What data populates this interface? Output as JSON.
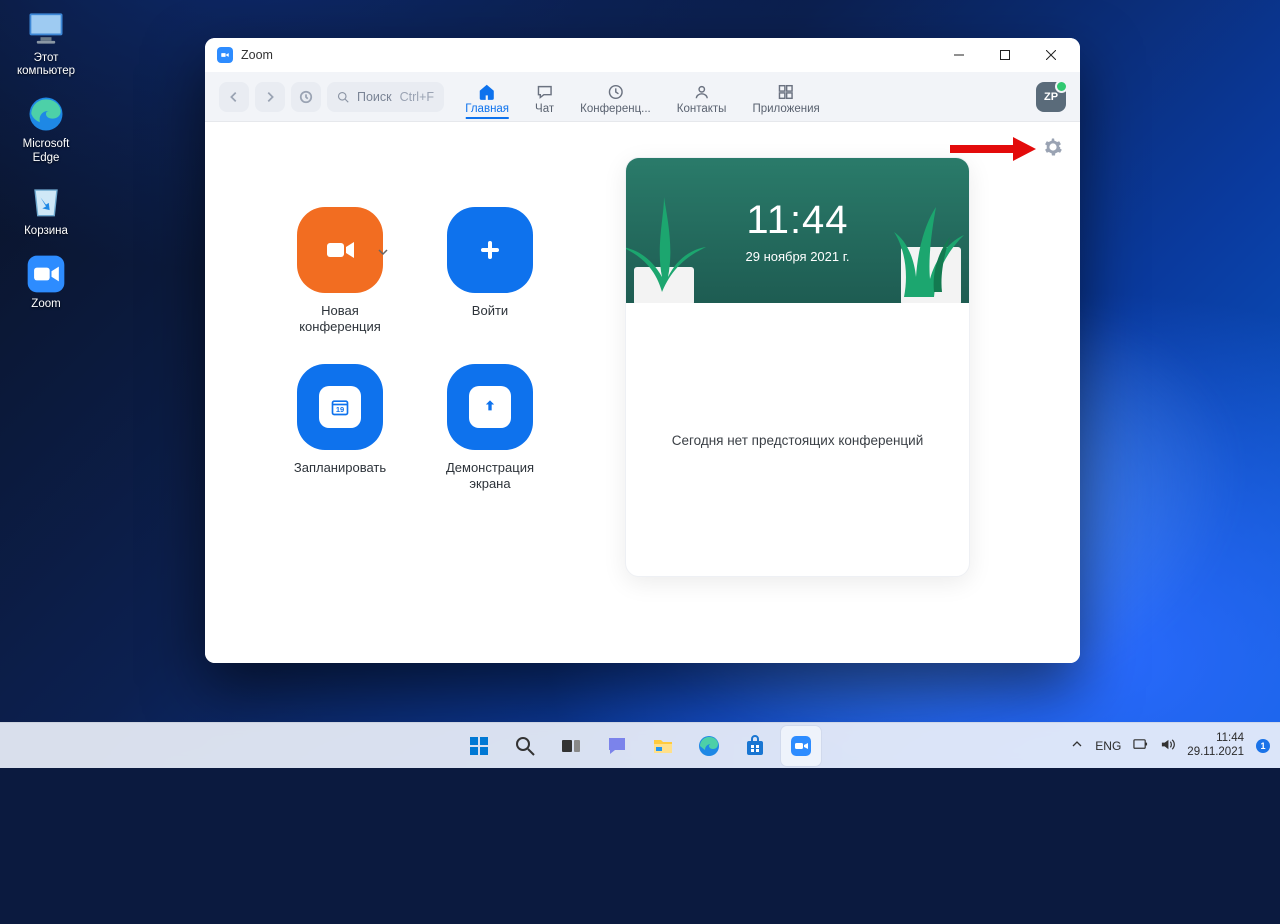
{
  "desktop": {
    "icons": [
      {
        "name": "this-pc",
        "label": "Этот\nкомпьютер"
      },
      {
        "name": "edge",
        "label": "Microsoft\nEdge"
      },
      {
        "name": "recycle-bin",
        "label": "Корзина"
      },
      {
        "name": "zoom",
        "label": "Zoom"
      }
    ]
  },
  "window": {
    "title": "Zoom",
    "search": {
      "placeholder": "Поиск",
      "shortcut": "Ctrl+F"
    },
    "tabs": {
      "home": "Главная",
      "chat": "Чат",
      "meetings": "Конференц...",
      "contacts": "Контакты",
      "apps": "Приложения"
    },
    "avatar": "ZP"
  },
  "home": {
    "actions": {
      "new_meeting": "Новая\nконференция",
      "join": "Войти",
      "schedule": "Запланировать",
      "share": "Демонстрация\nэкрана",
      "calendar_day": "19"
    },
    "clock": {
      "time": "11:44",
      "date": "29 ноября 2021 г."
    },
    "empty_msg": "Сегодня нет предстоящих конференций"
  },
  "taskbar": {
    "lang": "ENG",
    "time": "11:44",
    "date": "29.11.2021",
    "notif": "1"
  },
  "colors": {
    "accent": "#0e72ed",
    "orange": "#f26d21"
  }
}
